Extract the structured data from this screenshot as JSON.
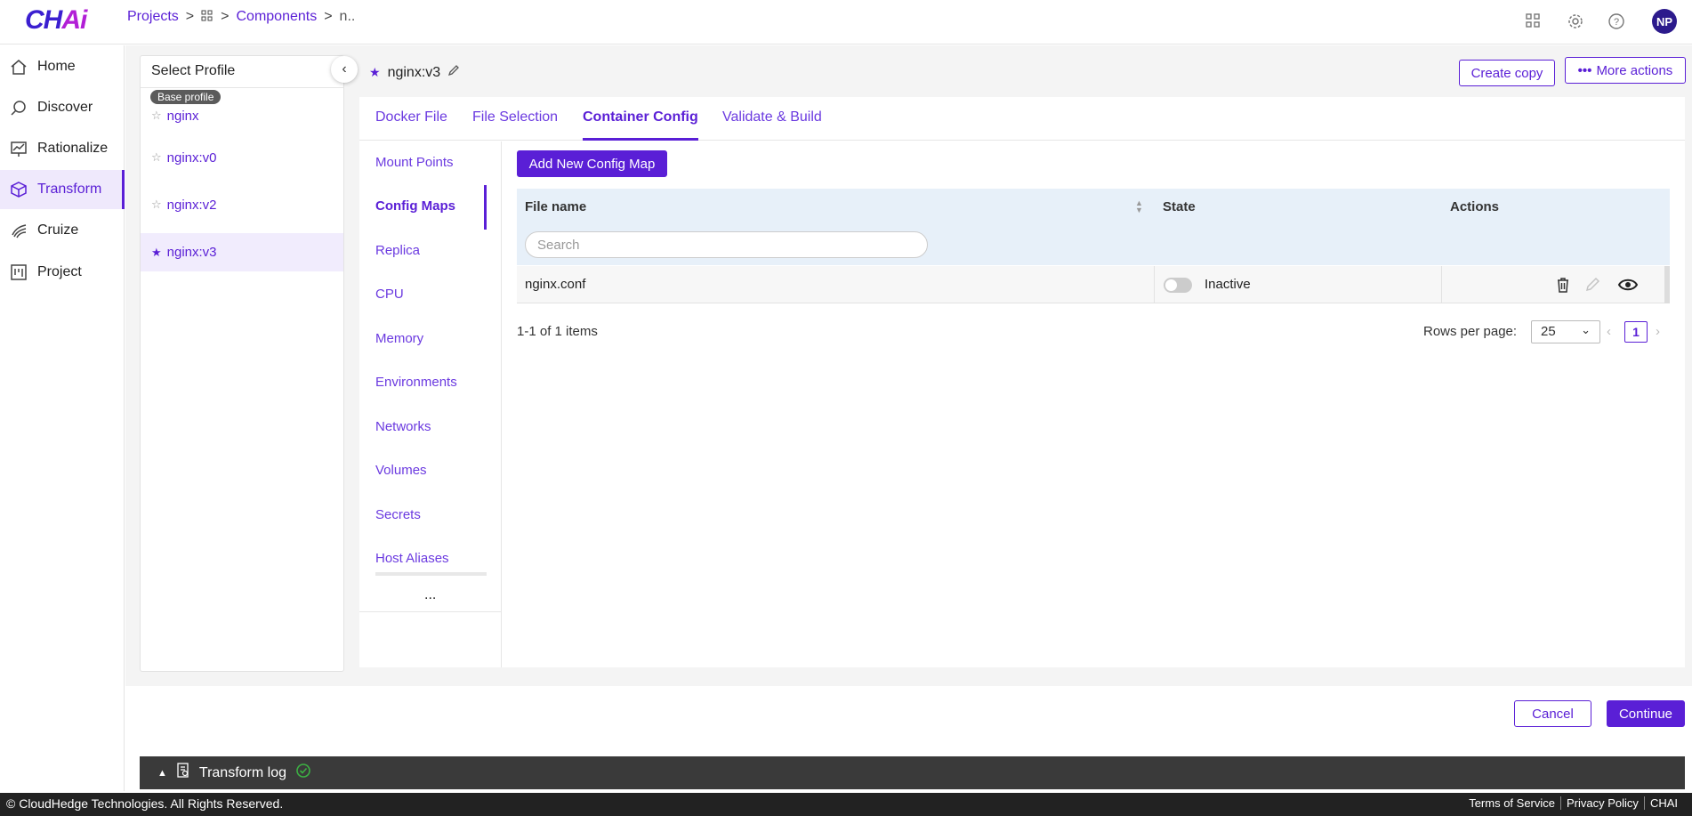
{
  "brand": {
    "logo_main": "CH",
    "logo_accent": "Ai"
  },
  "breadcrumb": {
    "projects": "Projects",
    "components": "Components",
    "current": "n.."
  },
  "user": {
    "initials": "NP"
  },
  "nav": [
    {
      "label": "Home",
      "icon": "home-icon"
    },
    {
      "label": "Discover",
      "icon": "discover-icon"
    },
    {
      "label": "Rationalize",
      "icon": "rationalize-icon"
    },
    {
      "label": "Transform",
      "icon": "transform-icon"
    },
    {
      "label": "Cruize",
      "icon": "cruize-icon"
    },
    {
      "label": "Project",
      "icon": "project-icon"
    }
  ],
  "profile_panel": {
    "title": "Select Profile",
    "badge": "Base profile",
    "items": [
      "nginx",
      "nginx:v0",
      "nginx:v2",
      "nginx:v3"
    ]
  },
  "header": {
    "title": "nginx:v3",
    "create_copy": "Create copy",
    "more_actions": "More actions"
  },
  "tabs": [
    "Docker File",
    "File Selection",
    "Container Config",
    "Validate & Build"
  ],
  "submenu": [
    "Mount Points",
    "Config Maps",
    "Replica",
    "CPU",
    "Memory",
    "Environments",
    "Networks",
    "Volumes",
    "Secrets",
    "Host Aliases"
  ],
  "submenu_more": "...",
  "config": {
    "add_button": "Add New Config Map",
    "columns": {
      "file_name": "File name",
      "state": "State",
      "actions": "Actions"
    },
    "search_placeholder": "Search",
    "rows": [
      {
        "file_name": "nginx.conf",
        "state": "Inactive"
      }
    ]
  },
  "pagination": {
    "summary": "1-1 of 1 items",
    "rows_label": "Rows per page:",
    "rows_value": "25",
    "page": "1"
  },
  "footer_actions": {
    "cancel": "Cancel",
    "continue": "Continue"
  },
  "logbar": {
    "label": "Transform log"
  },
  "footer": {
    "copyright": "© CloudHedge Technologies. All Rights Reserved.",
    "terms": "Terms of Service",
    "privacy": "Privacy Policy",
    "brand": "CHAI"
  },
  "colors": {
    "accent": "#5a1fd6",
    "header_row": "#e7f0f9"
  }
}
